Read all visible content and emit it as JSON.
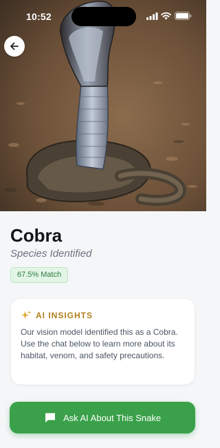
{
  "status_bar": {
    "time": "10:52",
    "icons": [
      "signal-icon",
      "wifi-icon",
      "battery-icon"
    ]
  },
  "hero": {
    "subject": "snake-photo",
    "back_icon": "arrow-left-icon"
  },
  "species": {
    "name": "Cobra",
    "subtitle": "Species Identified",
    "match_badge": "67.5% Match"
  },
  "insights": {
    "icon": "sparkle-icon",
    "label": "AI INSIGHTS",
    "text": "Our vision model identified this as a Cobra. Use the chat below to learn more about its habitat, venom, and safety precautions."
  },
  "cta": {
    "icon": "chat-bubble-icon",
    "label": "Ask AI About This Snake"
  },
  "colors": {
    "accent_green": "#3aa14a",
    "badge_green_bg": "#e2f5e6",
    "insights_gold": "#b07f1a"
  }
}
